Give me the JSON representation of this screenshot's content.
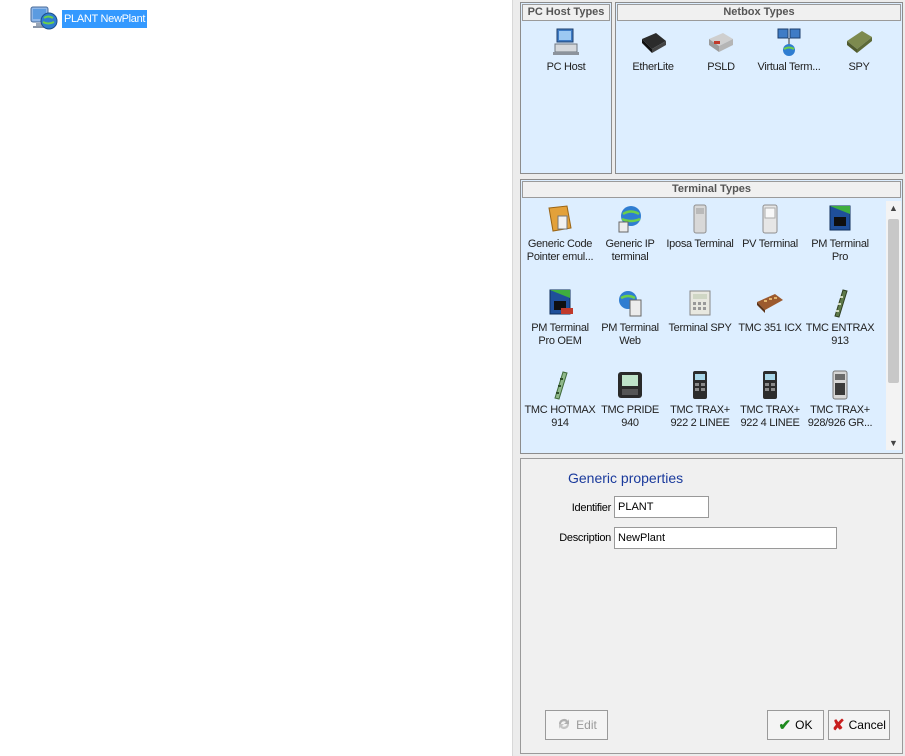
{
  "tree": {
    "node_label": "PLANT NewPlant",
    "node_icon": "globe-computer-icon"
  },
  "pc_host_panel": {
    "title": "PC Host Types",
    "items": [
      {
        "label": "PC Host",
        "icon": "pc-host-icon"
      }
    ]
  },
  "netbox_panel": {
    "title": "Netbox Types",
    "items": [
      {
        "label": "EtherLite",
        "icon": "etherlite-icon"
      },
      {
        "label": "PSLD",
        "icon": "psld-icon"
      },
      {
        "label": "Virtual Term...",
        "icon": "virtual-terminal-icon"
      },
      {
        "label": "SPY",
        "icon": "spy-board-icon"
      }
    ]
  },
  "terminal_panel": {
    "title": "Terminal Types",
    "items": [
      {
        "label": "Generic Code Pointer emul...",
        "icon": "generic-code-pointer-icon"
      },
      {
        "label": "Generic IP terminal",
        "icon": "generic-ip-terminal-icon"
      },
      {
        "label": "Iposa Terminal",
        "icon": "iposa-terminal-icon"
      },
      {
        "label": "PV Terminal",
        "icon": "pv-terminal-icon"
      },
      {
        "label": "PM Terminal Pro",
        "icon": "pm-terminal-pro-icon"
      },
      {
        "label": "PM Terminal Pro OEM",
        "icon": "pm-terminal-pro-oem-icon"
      },
      {
        "label": "PM Terminal Web",
        "icon": "pm-terminal-web-icon"
      },
      {
        "label": "Terminal SPY",
        "icon": "terminal-spy-icon"
      },
      {
        "label": "TMC 351 ICX",
        "icon": "tmc-351-icx-icon"
      },
      {
        "label": "TMC ENTRAX 913",
        "icon": "tmc-entrax-913-icon"
      },
      {
        "label": "TMC HOTMAX 914",
        "icon": "tmc-hotmax-914-icon"
      },
      {
        "label": "TMC PRIDE 940",
        "icon": "tmc-pride-940-icon"
      },
      {
        "label": "TMC TRAX+ 922 2 LINEE",
        "icon": "tmc-trax-922-2-icon"
      },
      {
        "label": "TMC TRAX+ 922 4 LINEE",
        "icon": "tmc-trax-922-4-icon"
      },
      {
        "label": "TMC TRAX+ 928/926 GR...",
        "icon": "tmc-trax-928-icon"
      }
    ],
    "scroll_up": "▲",
    "scroll_down": "▼"
  },
  "properties": {
    "title": "Generic properties",
    "identifier_label": "Identifier",
    "identifier_value": "PLANT",
    "description_label": "Description",
    "description_value": "NewPlant"
  },
  "buttons": {
    "edit": "Edit",
    "ok": "OK",
    "cancel": "Cancel"
  },
  "colors": {
    "selection": "#3399ff",
    "panel_bg": "#ddeeff",
    "title_blue": "#1a3a9c",
    "ok_check": "#1e8a1e",
    "cancel_x": "#c81e1e"
  }
}
